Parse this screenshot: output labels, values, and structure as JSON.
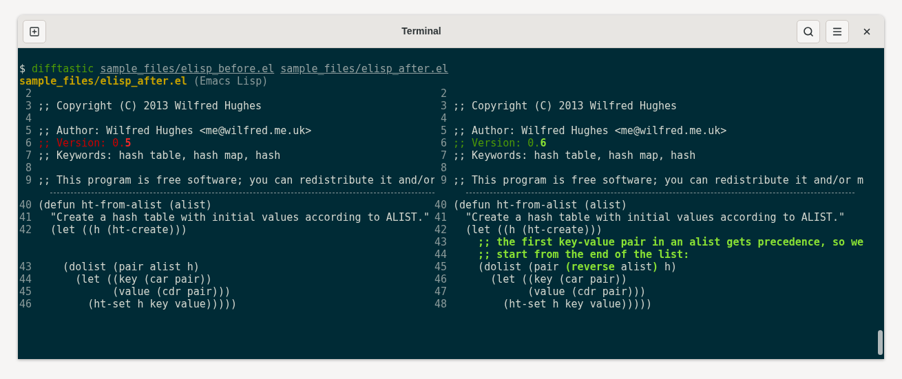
{
  "window": {
    "title": "Terminal"
  },
  "command_line": [
    {
      "text": "$ ",
      "kind": "prompt"
    },
    {
      "text": "difftastic",
      "kind": "command"
    },
    {
      "text": "sample_files/elisp_before.el",
      "kind": "path"
    },
    {
      "text": "sample_files/elisp_after.el",
      "kind": "path"
    }
  ],
  "file_header": [
    {
      "text": "sample_files/elisp_after.el",
      "kind": "filename"
    },
    {
      "text": " (Emacs Lisp)",
      "kind": "language"
    }
  ],
  "rows": [
    {
      "left": {
        "number": "2"
      },
      "right": {
        "number": "2"
      }
    },
    {
      "left": {
        "number": "3",
        "segments": [
          {
            "text": ";; Copyright (C) 2013 Wilfred Hughes",
            "kind": "plain"
          }
        ]
      },
      "right": {
        "number": "3",
        "segments": [
          {
            "text": ";; Copyright (C) 2013 Wilfred Hughes",
            "kind": "plain"
          }
        ]
      }
    },
    {
      "left": {
        "number": "4"
      },
      "right": {
        "number": "4"
      }
    },
    {
      "left": {
        "number": "5",
        "segments": [
          {
            "text": ";; Author: Wilfred Hughes <me@wilfred.me.uk>",
            "kind": "plain"
          }
        ]
      },
      "right": {
        "number": "5",
        "segments": [
          {
            "text": ";; Author: Wilfred Hughes <me@wilfred.me.uk>",
            "kind": "plain"
          }
        ]
      }
    },
    {
      "left": {
        "number": "6",
        "segments": [
          {
            "text": ";; Version: 0.",
            "kind": "removed"
          },
          {
            "text": "5",
            "kind": "removed_strong"
          }
        ]
      },
      "right": {
        "number": "6",
        "segments": [
          {
            "text": ";; Version: 0.",
            "kind": "added"
          },
          {
            "text": "6",
            "kind": "added_strong"
          }
        ]
      }
    },
    {
      "left": {
        "number": "7",
        "segments": [
          {
            "text": ";; Keywords: hash table, hash map, hash",
            "kind": "plain"
          }
        ]
      },
      "right": {
        "number": "7",
        "segments": [
          {
            "text": ";; Keywords: hash table, hash map, hash",
            "kind": "plain"
          }
        ]
      }
    },
    {
      "left": {
        "number": "8"
      },
      "right": {
        "number": "8"
      }
    },
    {
      "left": {
        "number": "9",
        "segments": [
          {
            "text": ";; This program is free software; you can redistribute it and/or",
            "kind": "plain"
          }
        ]
      },
      "right": {
        "number": "9",
        "segments": [
          {
            "text": ";; This program is free software; you can redistribute it and/or m",
            "kind": "plain"
          }
        ]
      }
    },
    {
      "kind": "separator"
    },
    {
      "left": {
        "number": "40",
        "segments": [
          {
            "text": "(defun ht-from-alist (alist)",
            "kind": "plain"
          }
        ]
      },
      "right": {
        "number": "40",
        "segments": [
          {
            "text": "(defun ht-from-alist (alist)",
            "kind": "plain"
          }
        ]
      }
    },
    {
      "left": {
        "number": "41",
        "segments": [
          {
            "text": "  \"Create a hash table with initial values according to ALIST.\"",
            "kind": "plain"
          }
        ]
      },
      "right": {
        "number": "41",
        "segments": [
          {
            "text": "  \"Create a hash table with initial values according to ALIST.\"",
            "kind": "plain"
          }
        ]
      }
    },
    {
      "left": {
        "number": "42",
        "segments": [
          {
            "text": "  (let ((h (ht-create)))",
            "kind": "plain"
          }
        ]
      },
      "right": {
        "number": "42",
        "segments": [
          {
            "text": "  (let ((h (ht-create)))",
            "kind": "plain"
          }
        ]
      }
    },
    {
      "right": {
        "number": "43",
        "segments": [
          {
            "text": "    ;; the first key-value pair in an alist gets precedence, so we",
            "kind": "added_strong"
          }
        ]
      }
    },
    {
      "right": {
        "number": "44",
        "segments": [
          {
            "text": "    ;; start from the end of the list:",
            "kind": "added_strong"
          }
        ]
      }
    },
    {
      "left": {
        "number": "43",
        "segments": [
          {
            "text": "    (dolist (pair alist h)",
            "kind": "plain"
          }
        ]
      },
      "right": {
        "number": "45",
        "segments": [
          {
            "text": "    (dolist (pair ",
            "kind": "plain"
          },
          {
            "text": "(reverse",
            "kind": "added_strong"
          },
          {
            "text": " alist",
            "kind": "plain"
          },
          {
            "text": ")",
            "kind": "added_strong"
          },
          {
            "text": " h)",
            "kind": "plain"
          }
        ]
      }
    },
    {
      "left": {
        "number": "44",
        "segments": [
          {
            "text": "      (let ((key (car pair))",
            "kind": "plain"
          }
        ]
      },
      "right": {
        "number": "46",
        "segments": [
          {
            "text": "      (let ((key (car pair))",
            "kind": "plain"
          }
        ]
      }
    },
    {
      "left": {
        "number": "45",
        "segments": [
          {
            "text": "            (value (cdr pair)))",
            "kind": "plain"
          }
        ]
      },
      "right": {
        "number": "47",
        "segments": [
          {
            "text": "            (value (cdr pair)))",
            "kind": "plain"
          }
        ]
      }
    },
    {
      "left": {
        "number": "46",
        "segments": [
          {
            "text": "        (ht-set h key value)))))",
            "kind": "plain"
          }
        ]
      },
      "right": {
        "number": "48",
        "segments": [
          {
            "text": "        (ht-set h key value)))))",
            "kind": "plain"
          }
        ]
      }
    }
  ]
}
